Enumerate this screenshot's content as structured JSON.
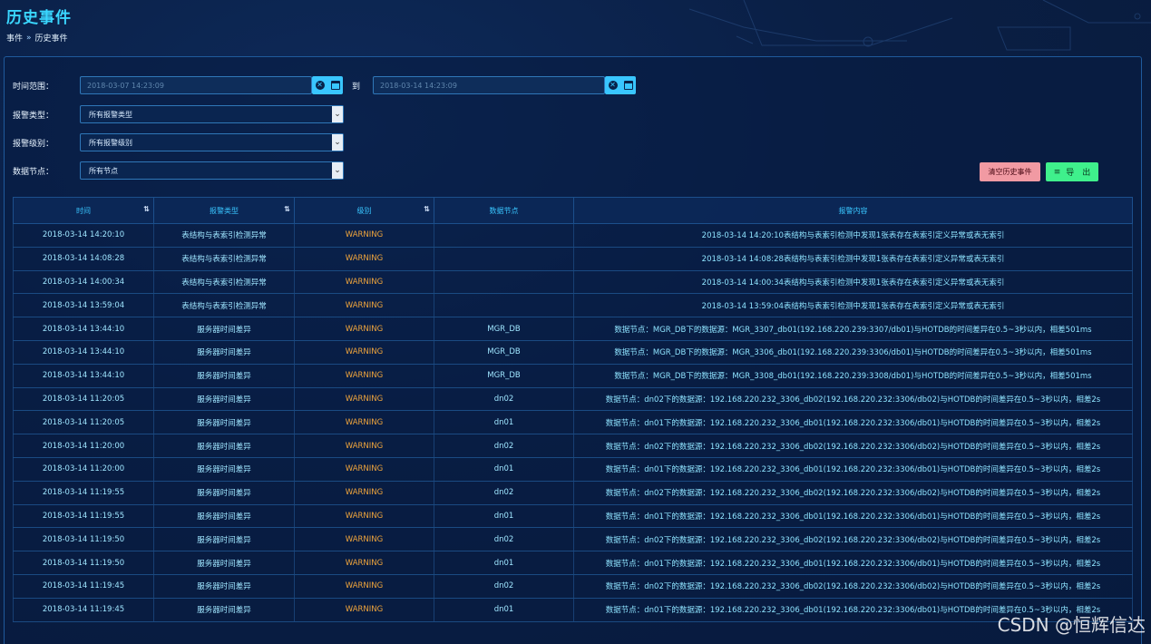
{
  "page": {
    "title": "历史事件",
    "breadcrumb": [
      "事件",
      "历史事件"
    ],
    "breadcrumb_sep": "»"
  },
  "filters": {
    "time_range_label": "时间范围：",
    "start_time": "2018-03-07 14:23:09",
    "to_label": "到",
    "end_time": "2018-03-14 14:23:09",
    "alarm_type_label": "报警类型：",
    "alarm_type_value": "所有报警类型",
    "alarm_level_label": "报警级别：",
    "alarm_level_value": "所有报警级别",
    "data_node_label": "数据节点：",
    "data_node_value": "所有节点"
  },
  "actions": {
    "clear_label": "清空历史事件",
    "export_label": "导　出"
  },
  "table": {
    "headers": [
      "时间",
      "报警类型",
      "级别",
      "数据节点",
      "报警内容"
    ],
    "rows": [
      [
        "2018-03-14 14:20:10",
        "表结构与表索引检测异常",
        "WARNING",
        "",
        "2018-03-14 14:20:10表结构与表索引检测中发现1张表存在表索引定义异常或表无索引"
      ],
      [
        "2018-03-14 14:08:28",
        "表结构与表索引检测异常",
        "WARNING",
        "",
        "2018-03-14 14:08:28表结构与表索引检测中发现1张表存在表索引定义异常或表无索引"
      ],
      [
        "2018-03-14 14:00:34",
        "表结构与表索引检测异常",
        "WARNING",
        "",
        "2018-03-14 14:00:34表结构与表索引检测中发现1张表存在表索引定义异常或表无索引"
      ],
      [
        "2018-03-14 13:59:04",
        "表结构与表索引检测异常",
        "WARNING",
        "",
        "2018-03-14 13:59:04表结构与表索引检测中发现1张表存在表索引定义异常或表无索引"
      ],
      [
        "2018-03-14 13:44:10",
        "服务器时间差异",
        "WARNING",
        "MGR_DB",
        "数据节点：MGR_DB下的数据源：MGR_3307_db01(192.168.220.239:3307/db01)与HOTDB的时间差异在0.5~3秒以内，相差501ms"
      ],
      [
        "2018-03-14 13:44:10",
        "服务器时间差异",
        "WARNING",
        "MGR_DB",
        "数据节点：MGR_DB下的数据源：MGR_3306_db01(192.168.220.239:3306/db01)与HOTDB的时间差异在0.5~3秒以内，相差501ms"
      ],
      [
        "2018-03-14 13:44:10",
        "服务器时间差异",
        "WARNING",
        "MGR_DB",
        "数据节点：MGR_DB下的数据源：MGR_3308_db01(192.168.220.239:3308/db01)与HOTDB的时间差异在0.5~3秒以内，相差501ms"
      ],
      [
        "2018-03-14 11:20:05",
        "服务器时间差异",
        "WARNING",
        "dn02",
        "数据节点：dn02下的数据源：192.168.220.232_3306_db02(192.168.220.232:3306/db02)与HOTDB的时间差异在0.5~3秒以内，相差2s"
      ],
      [
        "2018-03-14 11:20:05",
        "服务器时间差异",
        "WARNING",
        "dn01",
        "数据节点：dn01下的数据源：192.168.220.232_3306_db01(192.168.220.232:3306/db01)与HOTDB的时间差异在0.5~3秒以内，相差2s"
      ],
      [
        "2018-03-14 11:20:00",
        "服务器时间差异",
        "WARNING",
        "dn02",
        "数据节点：dn02下的数据源：192.168.220.232_3306_db02(192.168.220.232:3306/db02)与HOTDB的时间差异在0.5~3秒以内，相差2s"
      ],
      [
        "2018-03-14 11:20:00",
        "服务器时间差异",
        "WARNING",
        "dn01",
        "数据节点：dn01下的数据源：192.168.220.232_3306_db01(192.168.220.232:3306/db01)与HOTDB的时间差异在0.5~3秒以内，相差2s"
      ],
      [
        "2018-03-14 11:19:55",
        "服务器时间差异",
        "WARNING",
        "dn02",
        "数据节点：dn02下的数据源：192.168.220.232_3306_db02(192.168.220.232:3306/db02)与HOTDB的时间差异在0.5~3秒以内，相差2s"
      ],
      [
        "2018-03-14 11:19:55",
        "服务器时间差异",
        "WARNING",
        "dn01",
        "数据节点：dn01下的数据源：192.168.220.232_3306_db01(192.168.220.232:3306/db01)与HOTDB的时间差异在0.5~3秒以内，相差2s"
      ],
      [
        "2018-03-14 11:19:50",
        "服务器时间差异",
        "WARNING",
        "dn02",
        "数据节点：dn02下的数据源：192.168.220.232_3306_db02(192.168.220.232:3306/db02)与HOTDB的时间差异在0.5~3秒以内，相差2s"
      ],
      [
        "2018-03-14 11:19:50",
        "服务器时间差异",
        "WARNING",
        "dn01",
        "数据节点：dn01下的数据源：192.168.220.232_3306_db01(192.168.220.232:3306/db01)与HOTDB的时间差异在0.5~3秒以内，相差2s"
      ],
      [
        "2018-03-14 11:19:45",
        "服务器时间差异",
        "WARNING",
        "dn02",
        "数据节点：dn02下的数据源：192.168.220.232_3306_db02(192.168.220.232:3306/db02)与HOTDB的时间差异在0.5~3秒以内，相差2s"
      ],
      [
        "2018-03-14 11:19:45",
        "服务器时间差异",
        "WARNING",
        "dn01",
        "数据节点：dn01下的数据源：192.168.220.232_3306_db01(192.168.220.232:3306/db01)与HOTDB的时间差异在0.5~3秒以内，相差2s"
      ]
    ]
  },
  "watermark": "CSDN @恒辉信达",
  "colors": {
    "accent": "#39c6ff",
    "warning": "#f0a53c",
    "clear_button": "#f19aa3",
    "export_button": "#3ff08c"
  }
}
